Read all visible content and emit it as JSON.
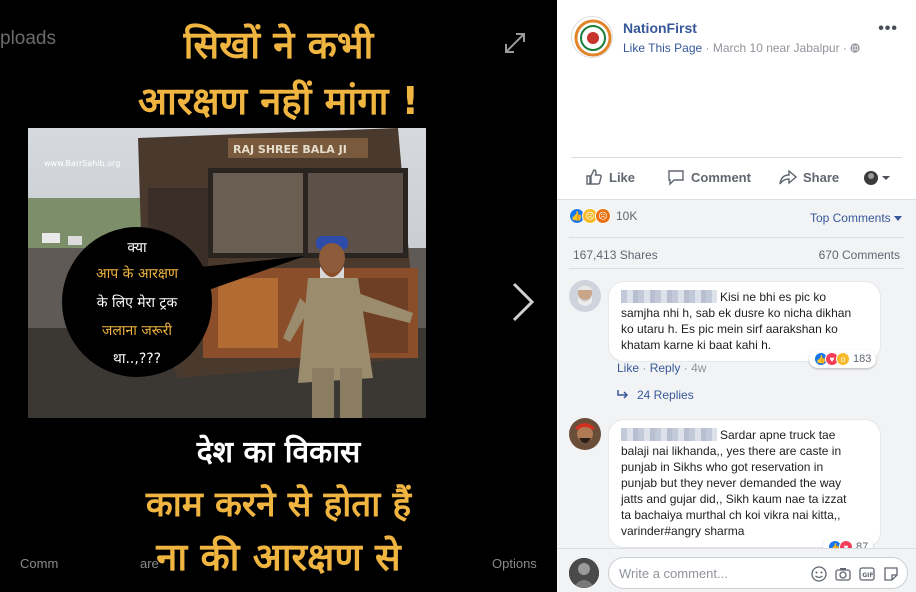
{
  "viewer": {
    "ghost_top_text": "ploads",
    "poster": {
      "headline_line1": "सिखों ने कभी",
      "headline_line2": "आरक्षण नहीं मांगा !",
      "watermark": "www.BarrSahib.org",
      "truck_board": "RAJ SHREE BALA JI",
      "bubble_lines": [
        "क्या",
        "आप के आरक्षण",
        "के लिए मेरा ट्रक",
        "जलाना जरूरी",
        "था..,???"
      ],
      "bottom_line1": "देश का विकास",
      "bottom_line2": "काम करने से होता हैं",
      "bottom_line3": "ना की आरक्षण से"
    },
    "bottom_comment_ghost": "Comm",
    "bottom_share_ghost": "are",
    "bottom_options_ghost": "Options"
  },
  "post": {
    "page_name": "NationFirst",
    "like_page_link": "Like This Page",
    "meta_sep": " · ",
    "date_location": "March 10 near Jabalpur · ",
    "more_label": "•••",
    "actions": {
      "like": "Like",
      "comment": "Comment",
      "share": "Share"
    },
    "reaction_count": "10K",
    "sort_label": "Top Comments",
    "shares_count": "167,413 Shares",
    "comments_count": "670 Comments"
  },
  "comments": [
    {
      "text": "Kisi ne bhi es pic ko samjha nhi h, sab ek dusre ko nicha dikhan ko utaru h. Es pic mein sirf aarakshan ko khatam karne ki baat kahi h.",
      "lines": [
        "Kisi ne bhi es pic ko",
        "samjha nhi h, sab ek dusre ko nicha dikhan",
        "ko utaru h. Es pic mein sirf aarakshan ko",
        "khatam karne ki baat kahi h."
      ],
      "like_label": "Like",
      "reply_label": "Reply",
      "time": "4w",
      "reaction_count": "183",
      "replies_label": "24 Replies"
    },
    {
      "lines": [
        "Sardar apne truck tae",
        "balaji nai likhanda,, yes there are caste in",
        "punjab in Sikhs who got reservation in",
        "punjab but they never demanded the way",
        "jatts and gujar did,, Sikh kaum nae ta izzat",
        "ta bachaiya murthal ch koi vikra nai kitta,,",
        "varinder#angry sharma"
      ],
      "reaction_count": "87"
    }
  ],
  "write_comment": {
    "placeholder": "Write a comment..."
  },
  "colors": {
    "link": "#365899",
    "poster_yellow": "#f0b540",
    "like_blue": "#1877f2",
    "love_red": "#f33e58"
  }
}
